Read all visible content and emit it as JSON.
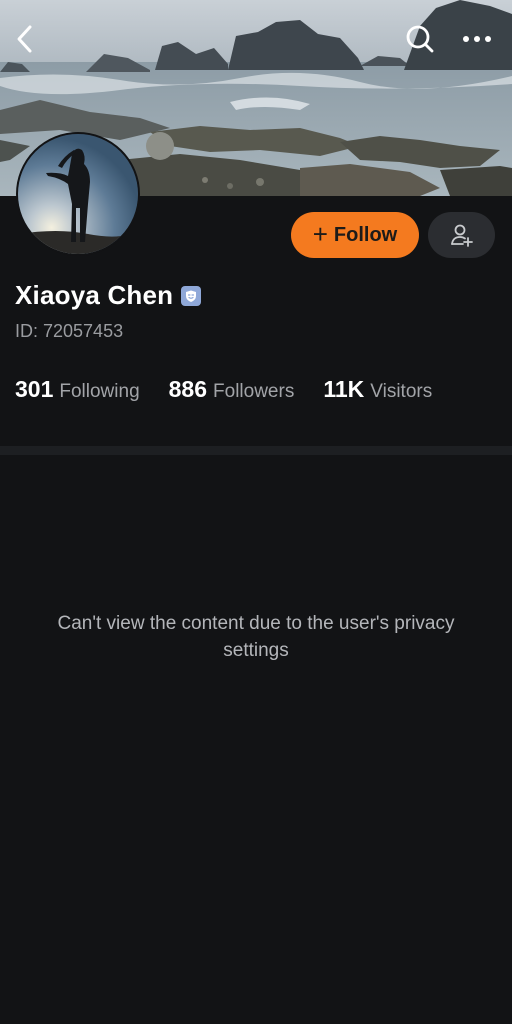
{
  "header": {
    "icons": {
      "back": "chevron-left-icon",
      "search": "search-icon",
      "more": "more-horizontal-icon"
    }
  },
  "profile": {
    "name": "Xiaoya Chen",
    "id_text": "ID: 72057453",
    "follow_label": "Follow",
    "follow_color": "#f47a1f"
  },
  "stats": [
    {
      "value": "301",
      "label": "Following"
    },
    {
      "value": "886",
      "label": "Followers"
    },
    {
      "value": "11K",
      "label": "Visitors"
    }
  ],
  "content": {
    "privacy_message": "Can't view the content due to the user's privacy settings"
  }
}
